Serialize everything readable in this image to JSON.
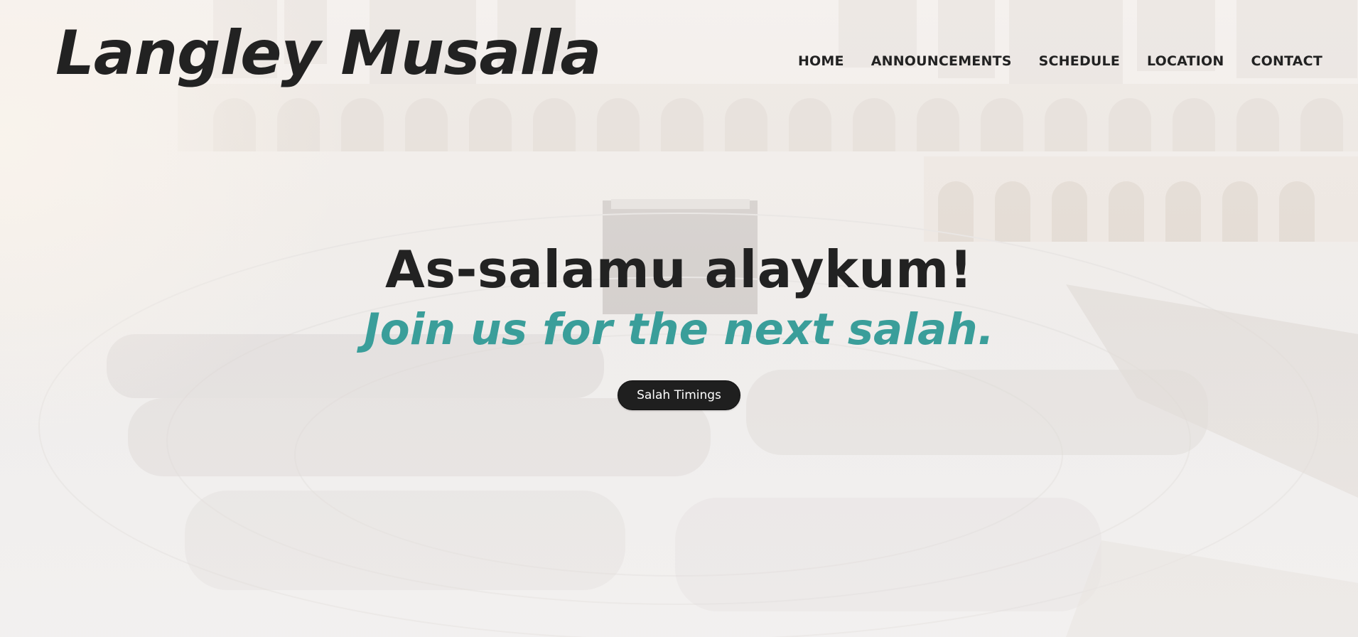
{
  "site": {
    "logo_text": "Langley Musalla"
  },
  "nav": {
    "items": [
      {
        "label": "HOME"
      },
      {
        "label": "ANNOUNCEMENTS"
      },
      {
        "label": "SCHEDULE"
      },
      {
        "label": "LOCATION"
      },
      {
        "label": "CONTACT"
      }
    ]
  },
  "hero": {
    "greeting": "As-salamu alaykum!",
    "tagline": "Join us for the next salah.",
    "cta_label": "Salah Timings",
    "background_icon": "mosque-courtyard-photo"
  },
  "colors": {
    "text_dark": "#222222",
    "accent_teal": "#3a9e9a",
    "button_bg": "#1f1f1f",
    "button_text": "#ffffff"
  }
}
